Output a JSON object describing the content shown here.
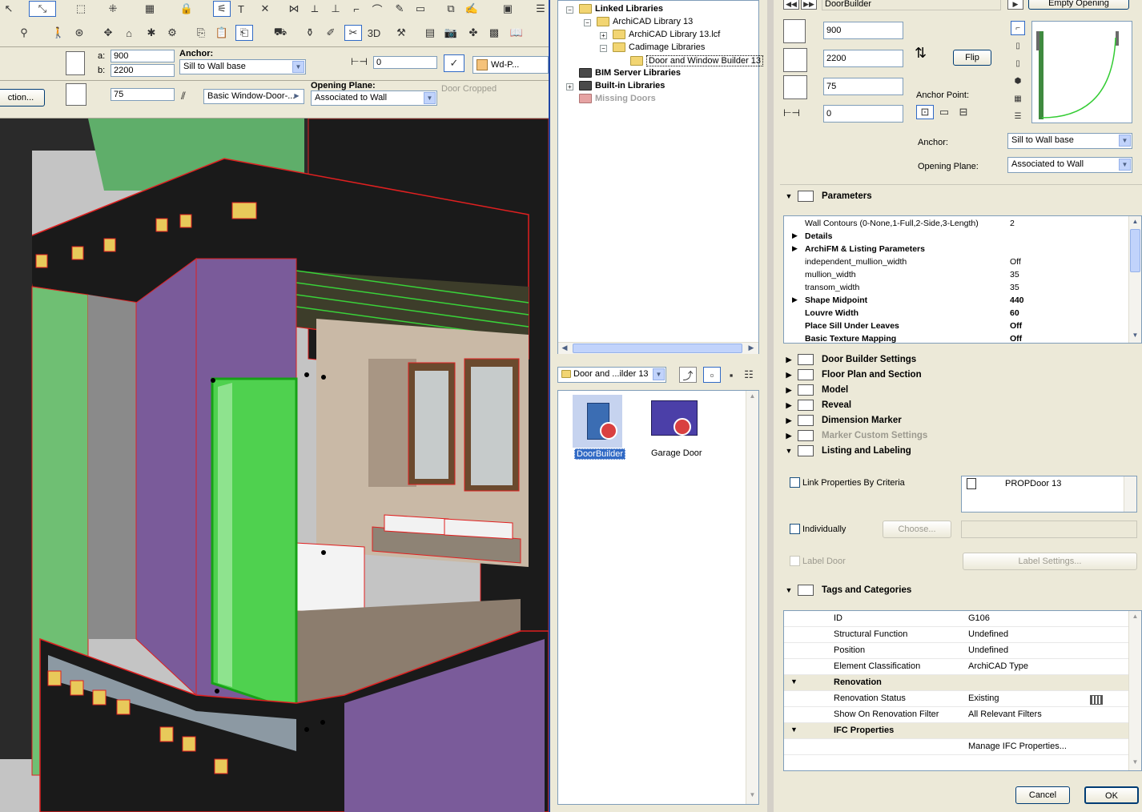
{
  "toolbar": {
    "a_label": "a:",
    "a_value": "900",
    "b_label": "b:",
    "b_value": "2200",
    "anchor_label": "Anchor:",
    "anchor_value": "Sill to Wall base",
    "offset_value": "0",
    "wd_label": "Wd-P...",
    "section_btn": "ction...",
    "sill_value": "75",
    "window_door_value": "Basic Window-Door-...",
    "opening_plane_label": "Opening Plane:",
    "opening_plane_value": "Associated to Wall",
    "door_cropped": "Door Cropped"
  },
  "library": {
    "tree": [
      {
        "label": "Linked Libraries",
        "bold": true
      },
      {
        "label": "ArchiCAD Library 13",
        "bold": false
      },
      {
        "label": "ArchiCAD Library 13.lcf",
        "bold": false
      },
      {
        "label": "Cadimage Libraries",
        "bold": false
      },
      {
        "label": "Door and Window Builder 13",
        "bold": false
      },
      {
        "label": "BIM Server Libraries",
        "bold": true
      },
      {
        "label": "Built-in Libraries",
        "bold": true
      },
      {
        "label": "Missing Doors",
        "bold": true
      }
    ],
    "folder_select": "Door and ...ilder 13",
    "items": [
      {
        "label": "DoorBuilder",
        "selected": true
      },
      {
        "label": "Garage Door",
        "selected": false
      }
    ]
  },
  "dialog": {
    "object_name": "DoorBuilder",
    "empty_opening": "Empty Opening",
    "width": "900",
    "height": "2200",
    "sill": "75",
    "offset": "0",
    "flip": "Flip",
    "anchor_point_label": "Anchor Point:",
    "anchor_label": "Anchor:",
    "anchor_value": "Sill to Wall base",
    "opening_plane_label": "Opening Plane:",
    "opening_plane_value": "Associated to Wall",
    "parameters_title": "Parameters",
    "parameters": [
      {
        "name": "Wall Contours (0-None,1-Full,2-Side,3-Length)",
        "value": "2",
        "bold": false,
        "expand": false
      },
      {
        "name": "Details",
        "value": "",
        "bold": true,
        "expand": true
      },
      {
        "name": "ArchiFM & Listing Parameters",
        "value": "",
        "bold": true,
        "expand": true
      },
      {
        "name": "independent_mullion_width",
        "value": "Off",
        "bold": false,
        "expand": false
      },
      {
        "name": "mullion_width",
        "value": "35",
        "bold": false,
        "expand": false
      },
      {
        "name": "transom_width",
        "value": "35",
        "bold": false,
        "expand": false
      },
      {
        "name": "Shape Midpoint",
        "value": "440",
        "bold": true,
        "expand": true
      },
      {
        "name": "Louvre Width",
        "value": "60",
        "bold": true,
        "expand": false
      },
      {
        "name": "Place Sill Under Leaves",
        "value": "Off",
        "bold": true,
        "expand": false
      },
      {
        "name": "Basic Texture Mapping",
        "value": "Off",
        "bold": true,
        "expand": false
      }
    ],
    "sections": [
      {
        "label": "Door Builder Settings",
        "disabled": false
      },
      {
        "label": "Floor Plan and Section",
        "disabled": false
      },
      {
        "label": "Model",
        "disabled": false
      },
      {
        "label": "Reveal",
        "disabled": false
      },
      {
        "label": "Dimension Marker",
        "disabled": false
      },
      {
        "label": "Marker Custom Settings",
        "disabled": true
      }
    ],
    "listing_title": "Listing and Labeling",
    "link_props": "Link Properties By Criteria",
    "prop_item": "PROPDoor 13",
    "individually": "Individually",
    "choose": "Choose...",
    "label_door": "Label Door",
    "label_settings": "Label Settings...",
    "tags_title": "Tags and Categories",
    "tags": [
      {
        "name": "ID",
        "value": "G106",
        "group": false
      },
      {
        "name": "Structural Function",
        "value": "Undefined",
        "group": false
      },
      {
        "name": "Position",
        "value": "Undefined",
        "group": false
      },
      {
        "name": "Element Classification",
        "value": "ArchiCAD Type",
        "group": false
      },
      {
        "name": "Renovation",
        "value": "",
        "group": true
      },
      {
        "name": "Renovation Status",
        "value": "Existing",
        "group": false
      },
      {
        "name": "Show On Renovation Filter",
        "value": "All Relevant Filters",
        "group": false
      },
      {
        "name": "IFC Properties",
        "value": "",
        "group": true
      },
      {
        "name": "",
        "value": "Manage IFC Properties...",
        "group": false
      }
    ],
    "cancel": "Cancel",
    "ok": "OK"
  },
  "colors": {
    "accent": "#316ac5",
    "purple_wall": "#7a5b9a",
    "green_wall": "#6fbf73",
    "selected_door": "#4fd14f",
    "outline": "#e02020"
  }
}
